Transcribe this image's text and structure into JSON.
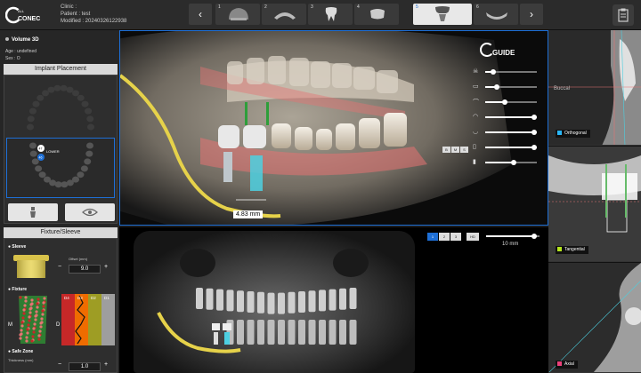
{
  "app": {
    "logo_text": "CONEC",
    "clinic_label": "Clinic :",
    "patient_label": "Patient : test",
    "modified_label": "Modified : 20240326122938"
  },
  "workflow": {
    "prev_icon": "chevron-left-icon",
    "next_icon": "chevron-right-icon",
    "steps": [
      {
        "num": "1",
        "icon": "skull-scan-icon"
      },
      {
        "num": "2",
        "icon": "jaw-model-icon"
      },
      {
        "num": "3",
        "icon": "tooth-icon"
      },
      {
        "num": "4",
        "icon": "crown-icon"
      },
      {
        "num": "5",
        "icon": "implant-icon",
        "active": true
      },
      {
        "num": "6",
        "icon": "guide-icon"
      }
    ],
    "report_icon": "clipboard-icon"
  },
  "volume": {
    "title": "Volume 3D",
    "age": "Age : undefined",
    "sex": "Sex : O"
  },
  "implant_panel": {
    "header": "Implant Placement",
    "arch_label": "LOWER",
    "tooth_a": "47",
    "tooth_b": "46",
    "implant_icon": "implant-icon",
    "view_icon": "eye-icon"
  },
  "fixture_panel": {
    "header": "Fixture/Sleeve",
    "sleeve_label": "Sleeve",
    "offset_label": "Offset (mm)",
    "offset_value": "9.0",
    "fixture_label": "Fixture",
    "density_labels": [
      "D4",
      "D3",
      "D2",
      "D1"
    ],
    "m_label": "M",
    "d_label": "D",
    "safe_zone_label": "Safe Zone",
    "thickness_label": "Thickness (mm)",
    "thickness_value": "1.0",
    "minus": "−",
    "plus": "+"
  },
  "view3d": {
    "measurement": "4.83 mm",
    "guide_logo": "GUIDE",
    "opacity_sliders": [
      {
        "icon": "skull-icon",
        "level": 0.15
      },
      {
        "icon": "teeth-row-icon",
        "level": 0.22
      },
      {
        "icon": "gum-icon",
        "level": 0.38
      },
      {
        "icon": "arch-icon",
        "level": 0.95
      },
      {
        "icon": "nerve-icon",
        "level": 0.95
      },
      {
        "icon": "sleeve-icon",
        "level": 0.95
      },
      {
        "icon": "implant-cylinder-icon",
        "level": 0.55
      }
    ],
    "view_buttons": [
      "B",
      "M",
      "S"
    ]
  },
  "pano": {
    "zoom_buttons": [
      "1",
      "2",
      "3",
      "HD"
    ],
    "slice_label": "10 mm",
    "slice_level": 0.9
  },
  "ct_views": [
    {
      "label": "Orthogonal",
      "color": "#29b6f6"
    },
    {
      "label": "Tangential",
      "color": "#b5e61d"
    },
    {
      "label": "Axial",
      "color": "#ec407a"
    }
  ],
  "buccal_label": "Buccal"
}
